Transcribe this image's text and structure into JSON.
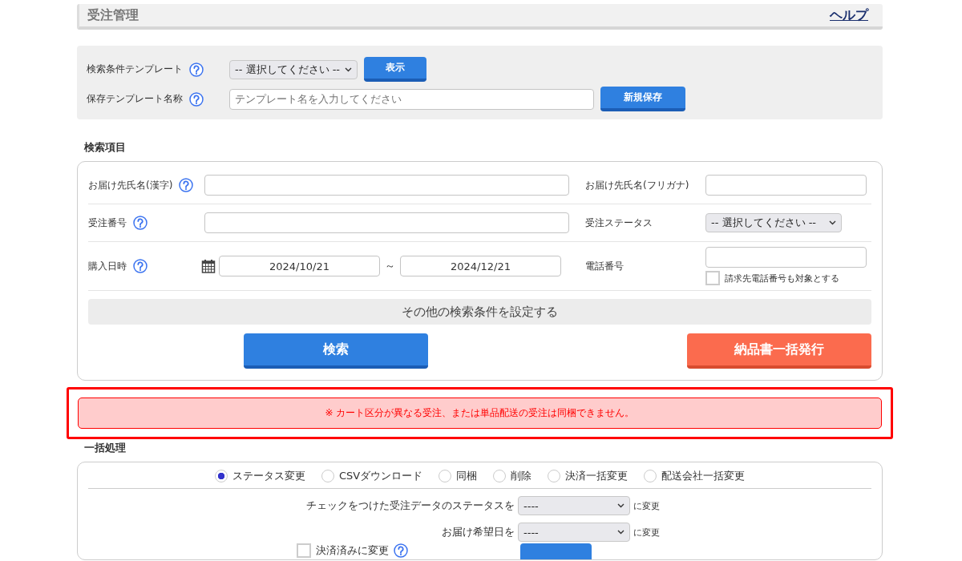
{
  "header": {
    "title": "受注管理",
    "help_link": "ヘルプ"
  },
  "template_panel": {
    "rows": [
      {
        "label": "検索条件テンプレート",
        "kind": "select",
        "value": "-- 選択してください --",
        "button": "表示"
      },
      {
        "label": "保存テンプレート名称",
        "kind": "text",
        "placeholder": "テンプレート名を入力してください",
        "button": "新規保存"
      }
    ]
  },
  "search_section": {
    "title": "検索項目",
    "fields": [
      {
        "label": "お届け先氏名(漢字)",
        "help": true,
        "kind": "text"
      },
      {
        "label": "お届け先氏名(フリガナ)",
        "help": false,
        "kind": "text"
      },
      {
        "label": "受注番号",
        "help": true,
        "kind": "text"
      },
      {
        "label": "受注ステータス",
        "help": false,
        "kind": "select",
        "value": "-- 選択してください --"
      },
      {
        "label": "購入日時",
        "help": true,
        "kind": "daterange",
        "from": "2024/10/21",
        "separator": "～",
        "to": "2024/12/21"
      },
      {
        "label": "電話番号",
        "help": false,
        "kind": "phone",
        "checkbox": {
          "label": "請求先電話番号も対象とする",
          "checked": false
        }
      }
    ],
    "more_conditions": "その他の検索条件を設定する",
    "search_button": "検索",
    "bulk_invoice_button": "納品書一括発行"
  },
  "alert": {
    "text": "※ カート区分が異なる受注、または単品配送の受注は同梱できません。",
    "highlighted": true
  },
  "bulk_section": {
    "title": "一括処理",
    "modes": [
      {
        "label": "ステータス変更",
        "selected": true
      },
      {
        "label": "CSVダウンロード",
        "selected": false
      },
      {
        "label": "同梱",
        "selected": false
      },
      {
        "label": "削除",
        "selected": false
      },
      {
        "label": "決済一括変更",
        "selected": false
      },
      {
        "label": "配送会社一括変更",
        "selected": false
      }
    ],
    "rows": [
      {
        "label": "チェックをつけた受注データのステータスを",
        "value": "----",
        "suffix": "に変更"
      },
      {
        "label": "お届け希望日を",
        "value": "----",
        "suffix": "に変更"
      }
    ],
    "paid_checkbox": {
      "label": "決済済みに変更",
      "checked": false
    }
  }
}
